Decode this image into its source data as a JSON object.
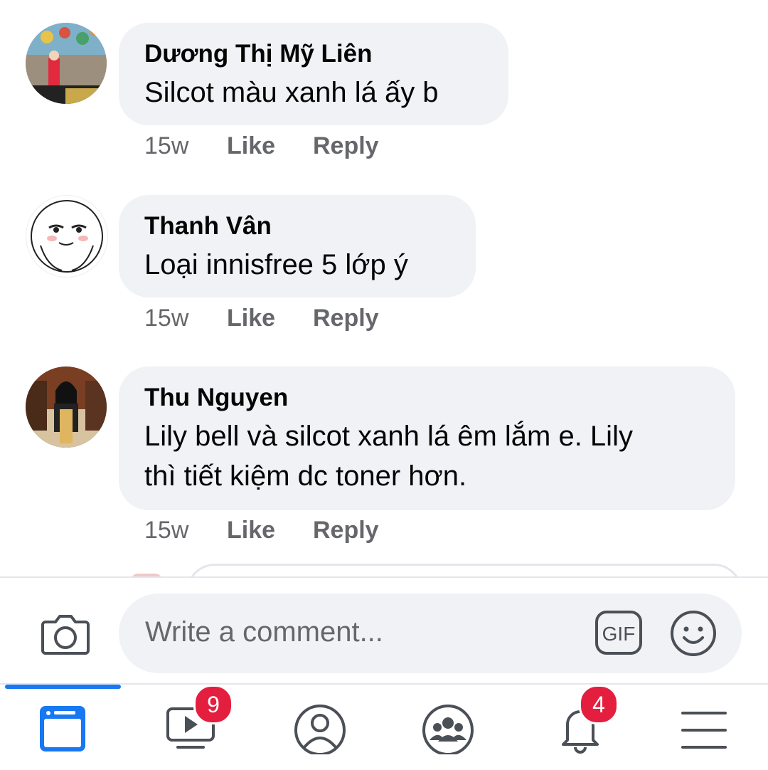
{
  "comments": [
    {
      "author": "Dương Thị Mỹ Liên",
      "text": "Silcot màu xanh lá ấy b",
      "time": "15w",
      "like": "Like",
      "reply": "Reply"
    },
    {
      "author": "Thanh Vân",
      "text": "Loại innisfree 5 lớp ý",
      "time": "15w",
      "like": "Like",
      "reply": "Reply"
    },
    {
      "author": "Thu Nguyen",
      "text_line1": "Lily bell và silcot xanh lá êm lắm e. Lily",
      "text_line2": "thì tiết kiệm dc toner hơn.",
      "time": "15w",
      "like": "Like",
      "reply": "Reply"
    }
  ],
  "composer": {
    "placeholder": "Write a comment...",
    "gif_label": "GIF"
  },
  "tabbar": {
    "watch_badge": "9",
    "notifications_badge": "4",
    "tabs": [
      "news-feed-icon",
      "watch-icon",
      "profile-icon",
      "groups-icon",
      "notifications-icon",
      "menu-icon"
    ]
  },
  "colors": {
    "accent": "#1877f2",
    "bubble": "#f0f2f5",
    "badge": "#e41e3f",
    "meta": "#65676b"
  }
}
